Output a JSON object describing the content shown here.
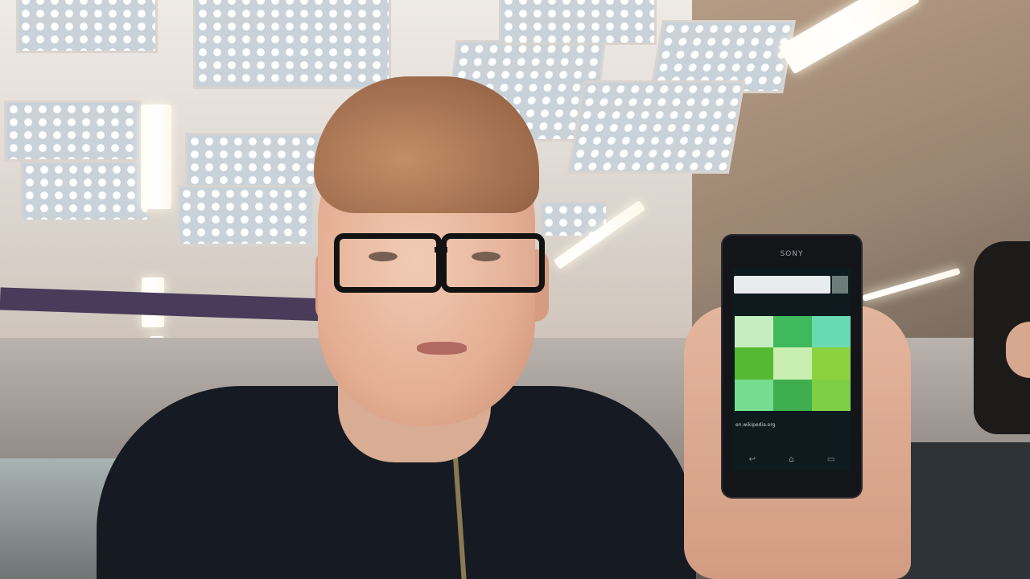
{
  "image": {
    "kind": "webcam-photo",
    "setting": "indoor-hall-with-skylights"
  },
  "phone": {
    "brand_text": "SONY",
    "caption_text": "en.wikipedia.org",
    "grid_colors": [
      "#c4eec0",
      "#3fb95c",
      "#69d9b4",
      "#55b934",
      "#c9efb0",
      "#8ed13f",
      "#75dd8f",
      "#3fae4f",
      "#7fcf45"
    ]
  },
  "colors": {
    "jacket": "#161a22",
    "glasses": "#121212",
    "hair": "#9d6a4b"
  }
}
